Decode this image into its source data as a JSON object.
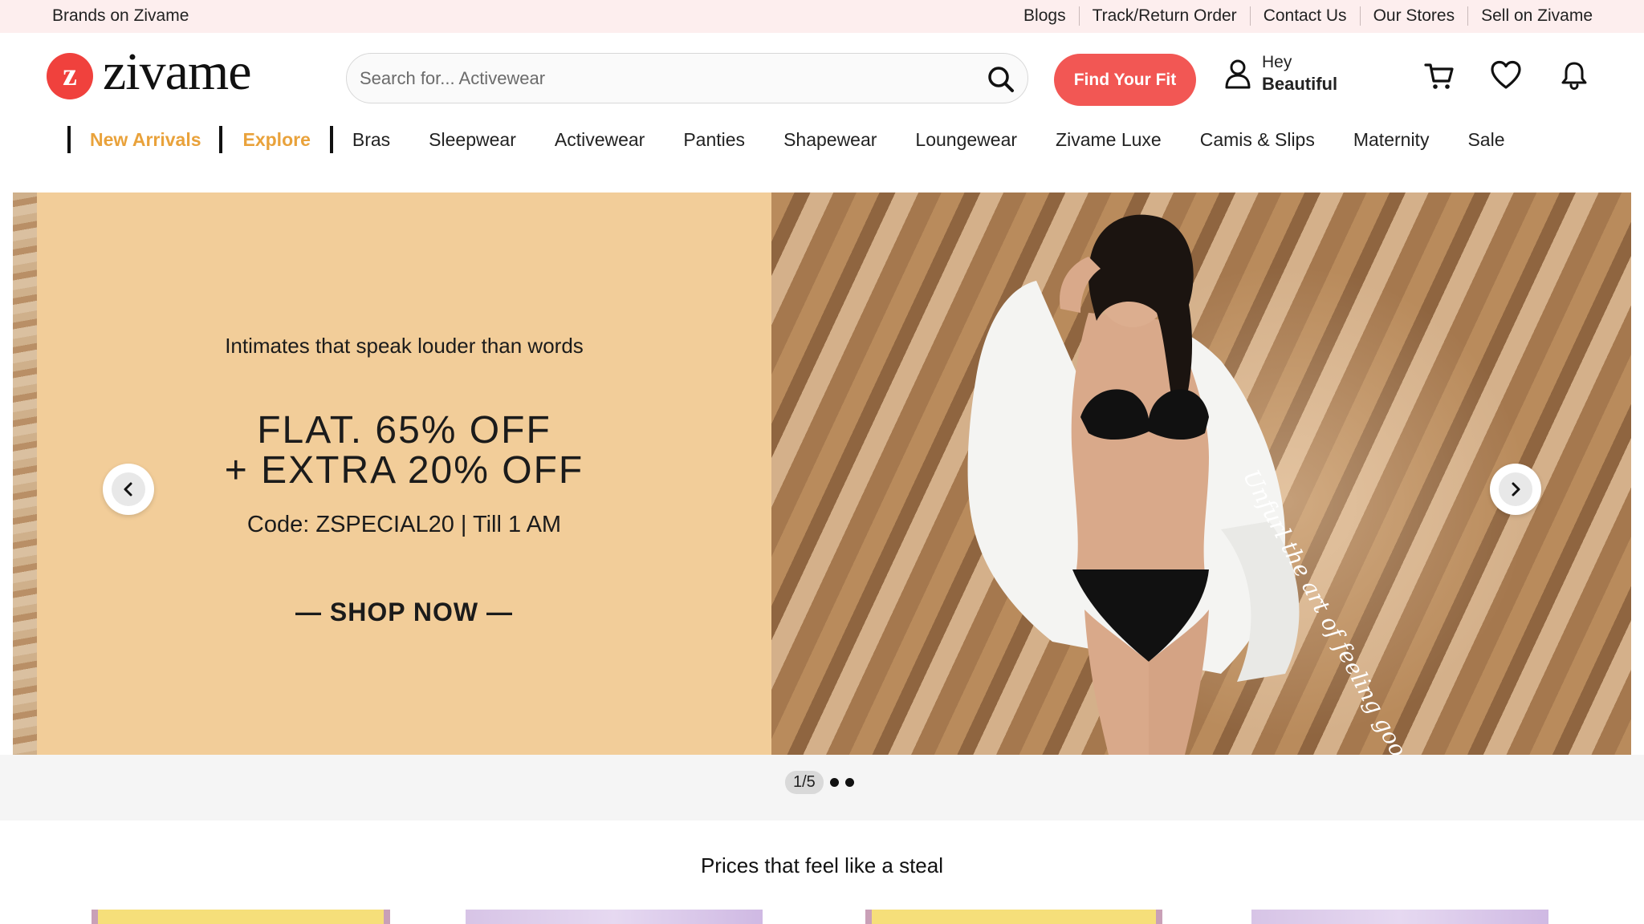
{
  "topbar": {
    "brands": "Brands on Zivame",
    "links": [
      "Blogs",
      "Track/Return Order",
      "Contact Us",
      "Our Stores",
      "Sell on Zivame"
    ]
  },
  "header": {
    "logo_mark": "z",
    "logo_text": "zivame",
    "search_placeholder": "Search for... Activewear",
    "find_fit": "Find Your Fit",
    "user_greeting": "Hey",
    "user_name": "Beautiful",
    "icons": [
      "cart-icon",
      "heart-icon",
      "bell-icon"
    ]
  },
  "nav": {
    "highlighted": [
      "New Arrivals",
      "Explore"
    ],
    "items": [
      "Bras",
      "Sleepwear",
      "Activewear",
      "Panties",
      "Shapewear",
      "Loungewear",
      "Zivame Luxe",
      "Camis & Slips",
      "Maternity",
      "Sale"
    ]
  },
  "hero": {
    "tagline": "Intimates that speak louder than words",
    "offer_line1": "FLAT. 65% OFF",
    "offer_line2": "+ EXTRA 20% OFF",
    "code": "Code: ZSPECIAL20 | Till 1 AM",
    "cta": "— SHOP NOW —",
    "script_text": "Unfurl the art of feeling good",
    "pager": "1/5"
  },
  "section": {
    "title": "Prices that feel like a steal"
  },
  "colors": {
    "accent": "#f25754",
    "highlight": "#e9a23b",
    "topbar_bg": "#fdeeee",
    "panel_bg": "#f2cd99"
  }
}
